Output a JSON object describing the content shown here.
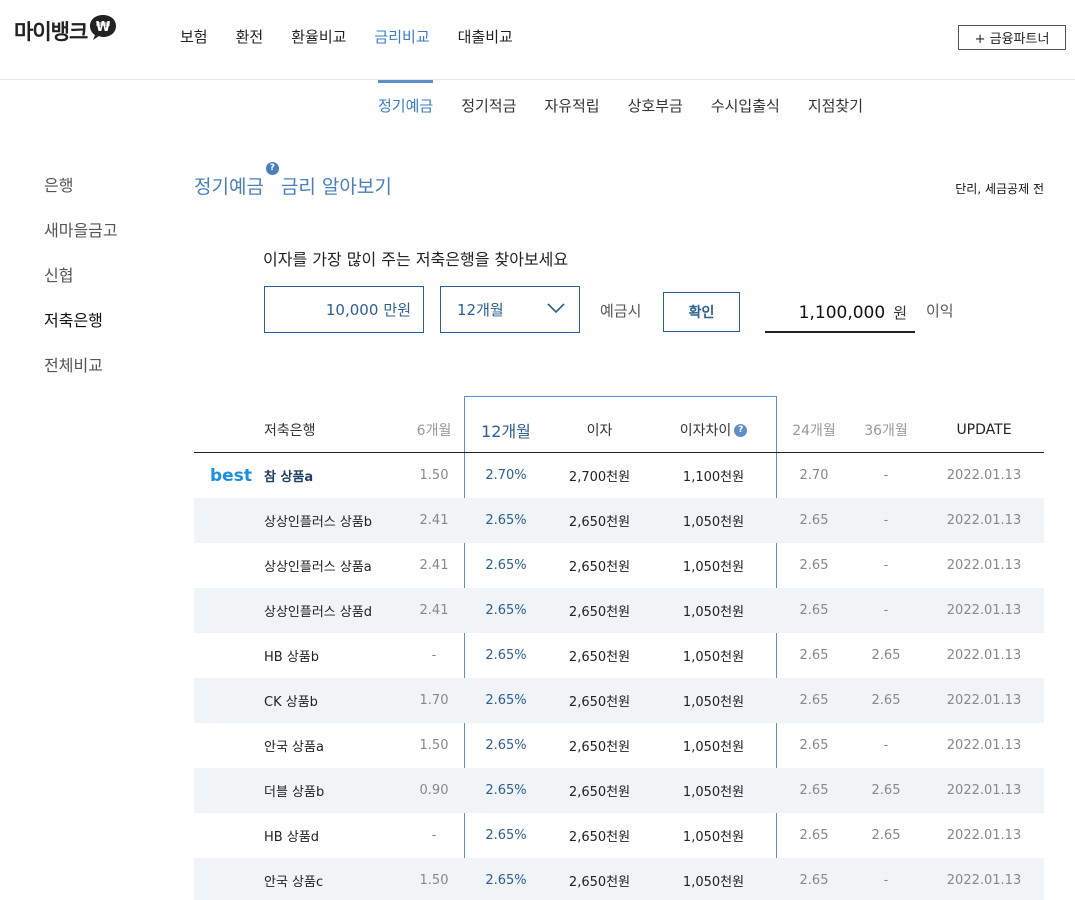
{
  "header": {
    "logo_text": "마이뱅크",
    "gnb": [
      "보험",
      "환전",
      "환율비교",
      "금리비교",
      "대출비교"
    ],
    "gnb_active": 3,
    "partner_button": "+ 금융파트너"
  },
  "subnav": {
    "items": [
      "정기예금",
      "정기적금",
      "자유적립",
      "상호부금",
      "수시입출식",
      "지점찾기"
    ],
    "active": 0
  },
  "lnb": {
    "items": [
      "은행",
      "새마을금고",
      "신협",
      "저축은행",
      "전체비교"
    ],
    "active": 3
  },
  "title": {
    "part1": "정기예금",
    "part2": "금리 알아보기",
    "help": "?",
    "note": "단리, 세금공제 전"
  },
  "search": {
    "lead": "이자를 가장 많이 주는 저축은행을 찾아보세요",
    "amount": "10,000",
    "amount_unit": "만원",
    "period": "12개월",
    "deposit_label": "예금시",
    "confirm": "확인",
    "result": "1,100,000",
    "result_unit": "원",
    "interest_label": "이익"
  },
  "table": {
    "headers": {
      "name": "저축은행",
      "m6": "6개월",
      "m12": "12개월",
      "interest": "이자",
      "diff": "이자차이",
      "m24": "24개월",
      "m36": "36개월",
      "update": "UPDATE"
    },
    "best_label": "best",
    "rows": [
      {
        "name": "참 상품a",
        "m6": "1.50",
        "m12": "2.70%",
        "interest": "2,700천원",
        "diff": "1,100천원",
        "m24": "2.70",
        "m36": "-",
        "update": "2022.01.13"
      },
      {
        "name": "상상인플러스 상품b",
        "m6": "2.41",
        "m12": "2.65%",
        "interest": "2,650천원",
        "diff": "1,050천원",
        "m24": "2.65",
        "m36": "-",
        "update": "2022.01.13"
      },
      {
        "name": "상상인플러스 상품a",
        "m6": "2.41",
        "m12": "2.65%",
        "interest": "2,650천원",
        "diff": "1,050천원",
        "m24": "2.65",
        "m36": "-",
        "update": "2022.01.13"
      },
      {
        "name": "상상인플러스 상품d",
        "m6": "2.41",
        "m12": "2.65%",
        "interest": "2,650천원",
        "diff": "1,050천원",
        "m24": "2.65",
        "m36": "-",
        "update": "2022.01.13"
      },
      {
        "name": "HB 상품b",
        "m6": "-",
        "m12": "2.65%",
        "interest": "2,650천원",
        "diff": "1,050천원",
        "m24": "2.65",
        "m36": "2.65",
        "update": "2022.01.13"
      },
      {
        "name": "CK 상품b",
        "m6": "1.70",
        "m12": "2.65%",
        "interest": "2,650천원",
        "diff": "1,050천원",
        "m24": "2.65",
        "m36": "2.65",
        "update": "2022.01.13"
      },
      {
        "name": "안국 상품a",
        "m6": "1.50",
        "m12": "2.65%",
        "interest": "2,650천원",
        "diff": "1,050천원",
        "m24": "2.65",
        "m36": "-",
        "update": "2022.01.13"
      },
      {
        "name": "더블 상품b",
        "m6": "0.90",
        "m12": "2.65%",
        "interest": "2,650천원",
        "diff": "1,050천원",
        "m24": "2.65",
        "m36": "2.65",
        "update": "2022.01.13"
      },
      {
        "name": "HB 상품d",
        "m6": "-",
        "m12": "2.65%",
        "interest": "2,650천원",
        "diff": "1,050천원",
        "m24": "2.65",
        "m36": "2.65",
        "update": "2022.01.13"
      },
      {
        "name": "안국 상품c",
        "m6": "1.50",
        "m12": "2.65%",
        "interest": "2,650천원",
        "diff": "1,050천원",
        "m24": "2.65",
        "m36": "-",
        "update": "2022.01.13"
      }
    ]
  }
}
